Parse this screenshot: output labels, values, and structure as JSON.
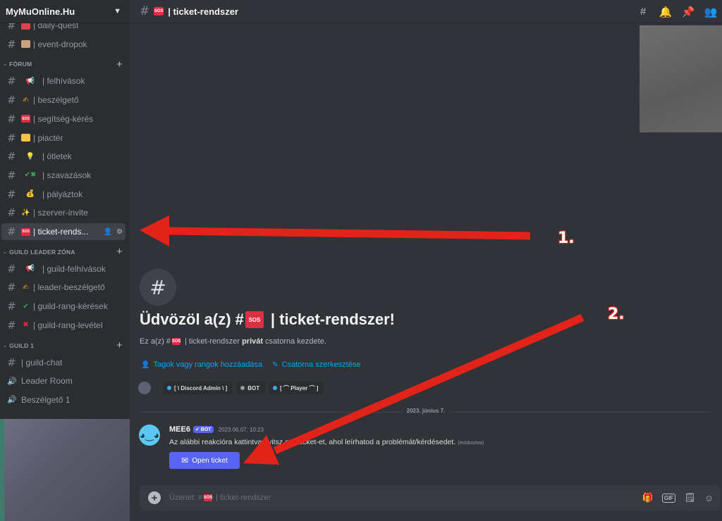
{
  "server": {
    "name": "MyMuOnline.Hu"
  },
  "sidebar": {
    "channels_top": [
      {
        "label": "| daily-quest",
        "emoji": "",
        "emoji_color": "#d9434e"
      },
      {
        "label": "| event-dropok",
        "emoji": "",
        "emoji_color": "#c8a27a"
      }
    ],
    "categories": [
      {
        "label": "FÓRUM",
        "items": [
          {
            "label": "| felhívások",
            "emoji": "📢",
            "emoji_color": "#dbdee1"
          },
          {
            "label": "| beszélgető",
            "emoji": "✍",
            "emoji_color": "#f4a623"
          },
          {
            "label": "| segítség-kérés",
            "emoji": "SOS",
            "emoji_color": "#dd2e44"
          },
          {
            "label": "| piactér",
            "emoji": "",
            "emoji_color": "#f4c542"
          },
          {
            "label": "| ötletek",
            "emoji": "💡",
            "emoji_color": "#f4c542"
          },
          {
            "label": "| szavazások",
            "emoji": "✔✖",
            "emoji_color": "#3ba55c"
          },
          {
            "label": "| pályáztok",
            "emoji": "💰",
            "emoji_color": "#e0a72a"
          },
          {
            "label": "| szerver-invite",
            "emoji": "✨",
            "emoji_color": "#f4c542"
          },
          {
            "label": "| ticket-rends...",
            "emoji": "SOS",
            "emoji_color": "#dd2e44",
            "active": true
          }
        ]
      },
      {
        "label": "GUILD LEADER ZÓNA",
        "items": [
          {
            "label": "| guild-felhívások",
            "emoji": "📢",
            "emoji_color": "#dbdee1"
          },
          {
            "label": "| leader-beszélgető",
            "emoji": "✍",
            "emoji_color": "#f4a623"
          },
          {
            "label": "| guild-rang-kérések",
            "emoji": "✔",
            "emoji_color": "#3ba55c"
          },
          {
            "label": "| guild-rang-levétel",
            "emoji": "✖",
            "emoji_color": "#dd2e44"
          }
        ]
      },
      {
        "label": "GUILD 1",
        "items": [
          {
            "label": "| guild-chat",
            "emoji": "",
            "emoji_color": ""
          },
          {
            "label": "Leader Room",
            "emoji": "",
            "emoji_color": "",
            "voice": true
          },
          {
            "label": "Beszélgető 1",
            "emoji": "",
            "emoji_color": "",
            "voice": true
          }
        ]
      }
    ]
  },
  "topbar": {
    "channel_title": "| ticket-rendszer",
    "icons": [
      "threads-icon",
      "bell-icon",
      "pin-icon",
      "members-icon"
    ]
  },
  "welcome": {
    "title_prefix": "Üdvözöl a(z) #",
    "title_suffix": "| ticket-rendszer!",
    "sub_prefix": "Ez a(z) #",
    "sub_mid": "| ticket-rendszer",
    "sub_bold": "privát",
    "sub_suffix": "csatorna kezdete.",
    "action_add": "Tagok vagy rangok hozzáadása",
    "action_edit": "Csatorna szerkesztése",
    "roles": [
      {
        "label": "[ \\ Discord Admin \\ ]",
        "color": "#3ba9e8"
      },
      {
        "label": "BOT",
        "color": "#949ba4"
      },
      {
        "label": "[ ⌒ Player ⌒ ]",
        "color": "#3ba9e8"
      }
    ]
  },
  "divider_date": "2023. június 7.",
  "message": {
    "author": "MEE6",
    "badge": "✔ BOT",
    "time": "2023.06.07. 10:23",
    "text": "Az alábbi reakcióra kattintva nyitsz egy ticket-et, ahol leírhatod a problémát/kérdésedet.",
    "edited": "(módosítva)",
    "button": "Open ticket"
  },
  "composer": {
    "placeholder_prefix": "Üzenet: #",
    "placeholder_suffix": "| ticket-rendszer",
    "gif_label": "GIF"
  },
  "annotations": {
    "one": "1.",
    "two": "2."
  },
  "colors": {
    "accent": "#5865f2",
    "arrow": "#e2231a",
    "link": "#00a8fc"
  }
}
